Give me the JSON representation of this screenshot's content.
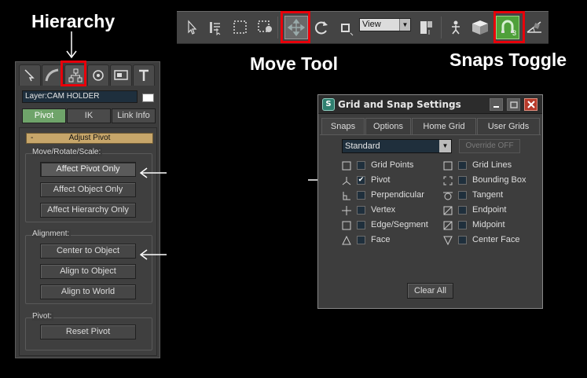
{
  "captions": {
    "hierarchy": "Hierarchy",
    "move_tool": "Move Tool",
    "snaps_toggle": "Snaps Toggle"
  },
  "toolbar": {
    "view_dropdown": "View",
    "icons": [
      "select-arrow-icon",
      "select-by-name-icon",
      "rect-region-icon",
      "window-crossing-icon",
      "move-tool-icon",
      "rotate-icon",
      "scale-icon",
      "view-dropdown",
      "pivot-center-icon",
      "link-icon",
      "box-icon",
      "snaps-toggle-icon",
      "angle-snap-icon"
    ],
    "snap_badge": "3"
  },
  "command_panel": {
    "tabs": [
      "create-tab",
      "modify-tab",
      "hierarchy-tab",
      "motion-tab",
      "display-tab",
      "utilities-tab"
    ],
    "layer": "Layer:CAM HOLDER",
    "mode_buttons": [
      "Pivot",
      "IK",
      "Link Info"
    ],
    "rollout_title": "Adjust Pivot",
    "rollout_minus": "-",
    "move_group_label": "Move/Rotate/Scale:",
    "affect_pivot": "Affect Pivot Only",
    "affect_object": "Affect Object Only",
    "affect_hierarchy": "Affect Hierarchy Only",
    "alignment_label": "Alignment:",
    "center_to_object": "Center to Object",
    "align_to_object": "Align to Object",
    "align_to_world": "Align to World",
    "pivot_label": "Pivot:",
    "reset_pivot": "Reset Pivot"
  },
  "dialog": {
    "title": "Grid and Snap Settings",
    "app_icon": "S",
    "tabs": [
      "Snaps",
      "Options",
      "Home Grid",
      "User Grids"
    ],
    "snap_type": "Standard",
    "override": "Override OFF",
    "left_snaps": [
      {
        "label": "Grid Points",
        "checked": false
      },
      {
        "label": "Pivot",
        "checked": true
      },
      {
        "label": "Perpendicular",
        "checked": false
      },
      {
        "label": "Vertex",
        "checked": false
      },
      {
        "label": "Edge/Segment",
        "checked": false
      },
      {
        "label": "Face",
        "checked": false
      }
    ],
    "right_snaps": [
      {
        "label": "Grid Lines",
        "checked": false
      },
      {
        "label": "Bounding Box",
        "checked": false
      },
      {
        "label": "Tangent",
        "checked": false
      },
      {
        "label": "Endpoint",
        "checked": false
      },
      {
        "label": "Midpoint",
        "checked": false
      },
      {
        "label": "Center Face",
        "checked": false
      }
    ],
    "check_mark": "✔",
    "clear_all": "Clear All"
  },
  "colors": {
    "highlight": "#e8000a",
    "pivot_active": "#6fa46a",
    "rollout_header": "#c7a66a",
    "snap_toggle_green": "#4fa03a"
  }
}
